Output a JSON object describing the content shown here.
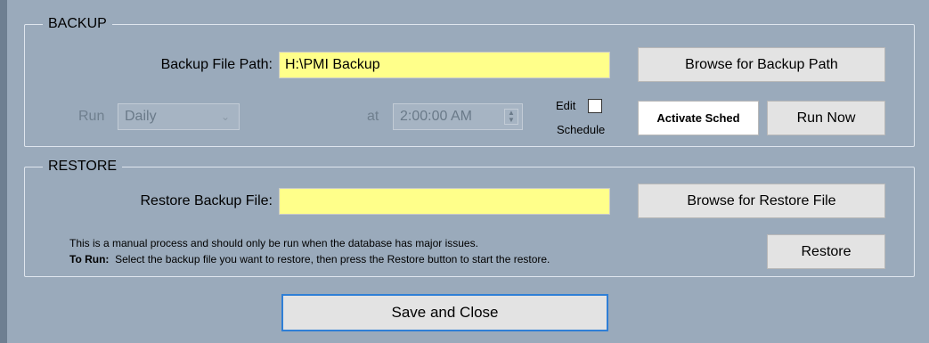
{
  "backup": {
    "legend": "BACKUP",
    "path_label": "Backup File Path:",
    "path_value": "H:\\PMI Backup",
    "browse_label": "Browse for Backup Path",
    "run_label": "Run",
    "run_frequency": "Daily",
    "at_label": "at",
    "time_value": "2:00:00 AM",
    "edit_label": "Edit",
    "schedule_label": "Schedule",
    "activate_label": "Activate Sched",
    "run_now_label": "Run Now"
  },
  "restore": {
    "legend": "RESTORE",
    "file_label": "Restore Backup File:",
    "file_value": "",
    "browse_label": "Browse for Restore File",
    "note_line1": "This is a manual process and should only be run when the database has major issues.",
    "note_bold": "To Run:",
    "note_line2": "Select the backup file you want to restore, then press the Restore button to start the restore.",
    "restore_label": "Restore"
  },
  "footer": {
    "save_close_label": "Save and Close"
  },
  "colors": {
    "background": "#9aaabb",
    "field_yellow": "#ffff8a",
    "button": "#e3e3e3"
  }
}
